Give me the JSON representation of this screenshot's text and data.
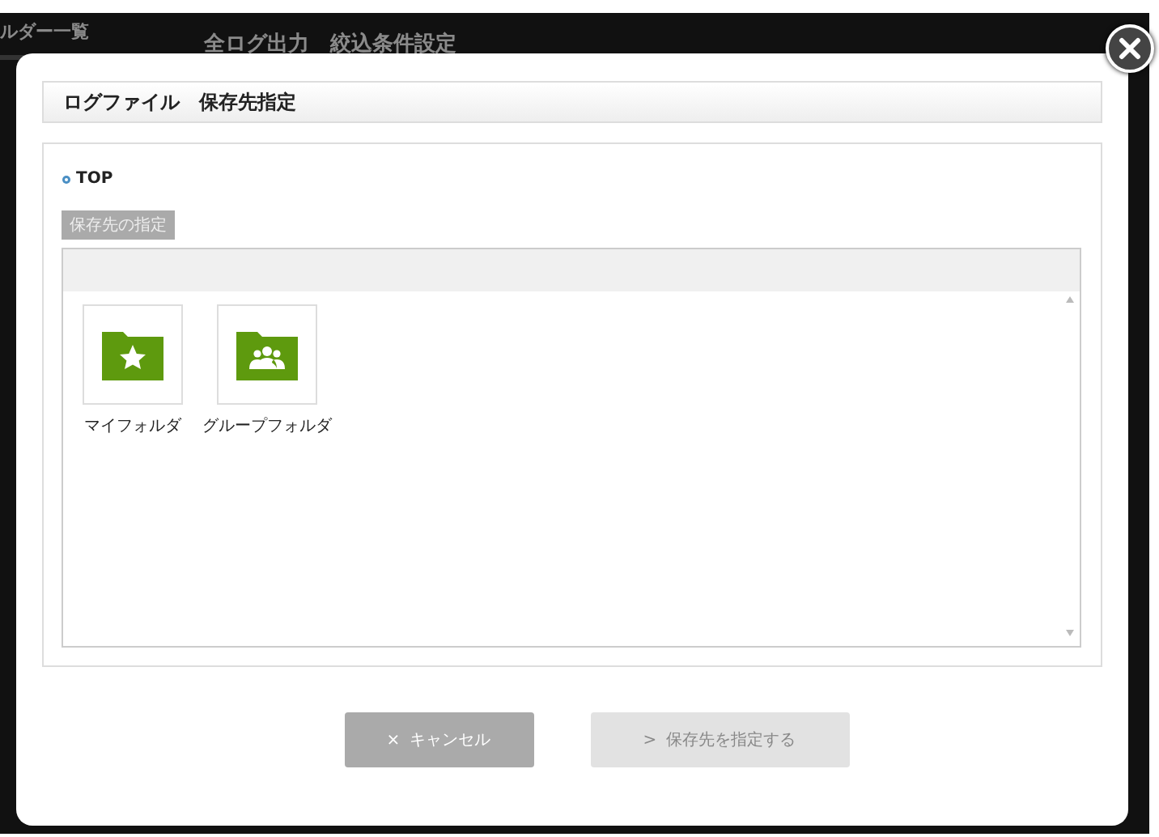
{
  "background": {
    "sidebar_title": "ルダー一覧",
    "page_title": "全ログ出力　絞込条件設定"
  },
  "dialog": {
    "title": "ログファイル　保存先指定",
    "breadcrumb": "TOP",
    "section_label": "保存先の指定",
    "folders": [
      {
        "kind": "favorite",
        "label": "マイフォルダ"
      },
      {
        "kind": "group",
        "label": "グループフォルダ"
      }
    ],
    "buttons": [
      {
        "icon": "×",
        "label": "キャンセル",
        "disabled": false
      },
      {
        "icon": ">",
        "label": "保存先を指定する",
        "disabled": true
      }
    ]
  }
}
